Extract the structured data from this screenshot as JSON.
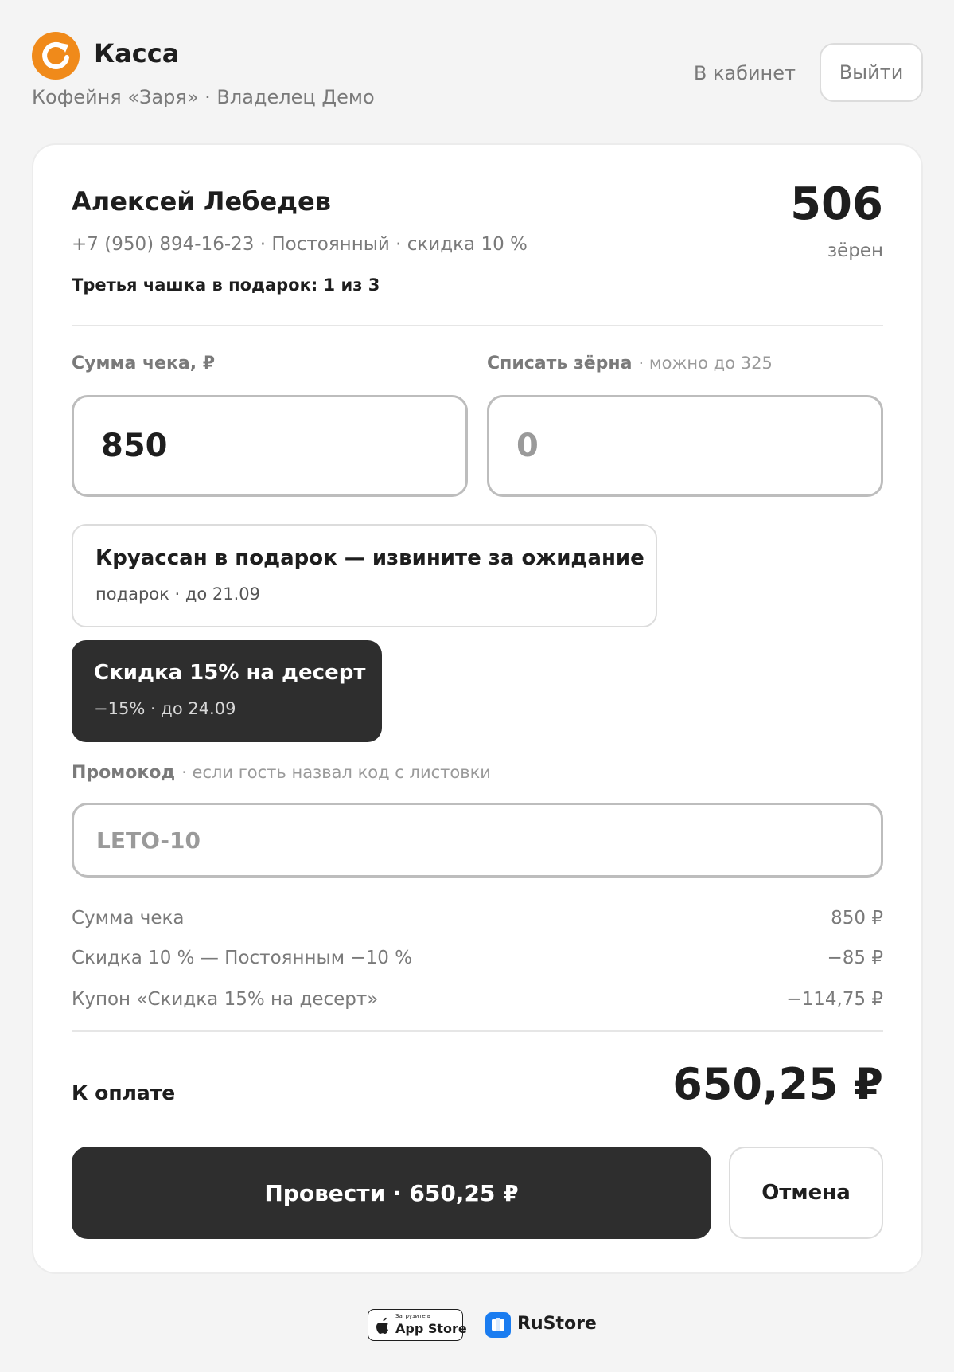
{
  "header": {
    "title": "Касса",
    "subtitle": "Кофейня «Заря» · Владелец Демо",
    "cabinet_link": "В кабинет",
    "logout_label": "Выйти",
    "logo_icon": "refresh-c-logo-icon",
    "accent_color": "#f08a1a"
  },
  "client": {
    "name": "Алексей Лебедев",
    "meta": "+7 (950) 894-16-23 · Постоянный · скидка 10 %",
    "promo_progress": "Третья чашка в подарок: 1 из 3",
    "beans_value": "506",
    "beans_label": "зёрен"
  },
  "check": {
    "amount_label": "Сумма чека, ₽",
    "amount_value": "850",
    "beans_label": "Списать зёрна",
    "beans_hint": "· можно до 325",
    "beans_placeholder": "0"
  },
  "coupons": [
    {
      "title": "Круассан в подарок — извините за ожидание",
      "sub": "подарок · до 21.09",
      "selected": false
    },
    {
      "title": "Скидка 15% на десерт",
      "sub": "−15% · до 24.09",
      "selected": true
    }
  ],
  "promo": {
    "label": "Промокод",
    "hint": "· если гость назвал код с листовки",
    "placeholder": "LETO-10"
  },
  "summary": [
    {
      "label": "Сумма чека",
      "value": "850 ₽"
    },
    {
      "label": "Скидка 10 % — Постоянным −10 %",
      "value": "−85 ₽"
    },
    {
      "label": "Купон «Скидка 15% на десерт»",
      "value": "−114,75 ₽"
    }
  ],
  "total": {
    "label": "К оплате",
    "value": "650,25 ₽"
  },
  "actions": {
    "pay_label": "Провести · 650,25 ₽",
    "cancel_label": "Отмена",
    "primary_color": "#2e2e2e"
  },
  "stores": {
    "appstore_small": "Загрузите в",
    "appstore_big": "App Store",
    "rustore": "RuStore"
  }
}
